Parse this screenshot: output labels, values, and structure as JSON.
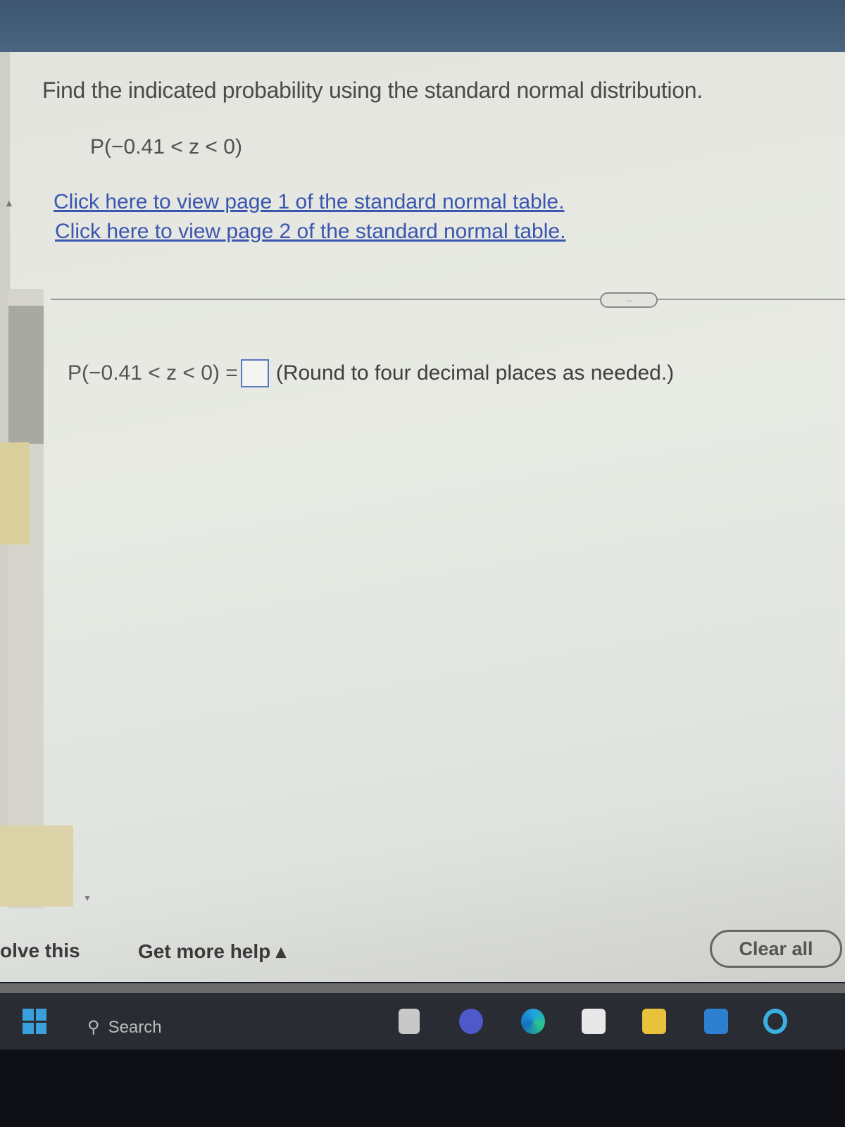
{
  "question": {
    "title": "Find the indicated probability using the standard normal distribution.",
    "expression": "P(−0.41 < z < 0)",
    "links": [
      "Click here to view page 1 of the standard normal table.",
      "Click here to view page 2 of the standard normal table."
    ],
    "more_label": "...",
    "answer_label": "P(−0.41 < z < 0) =",
    "answer_value": "",
    "hint": "(Round to four decimal places as needed.)"
  },
  "footer": {
    "solve_label": "olve this",
    "help_label": "Get more help ▴",
    "clear_label": "Clear all"
  },
  "taskbar": {
    "search_label": "Search",
    "icons": [
      "windows-start-icon",
      "search-icon",
      "task-view-icon",
      "teams-icon",
      "edge-icon",
      "store-icon",
      "file-explorer-icon",
      "mail-icon",
      "cortana-icon"
    ]
  },
  "colors": {
    "link": "#3a56b0",
    "answer_box_border": "#5a78c0",
    "taskbar": "#2a2c33"
  }
}
